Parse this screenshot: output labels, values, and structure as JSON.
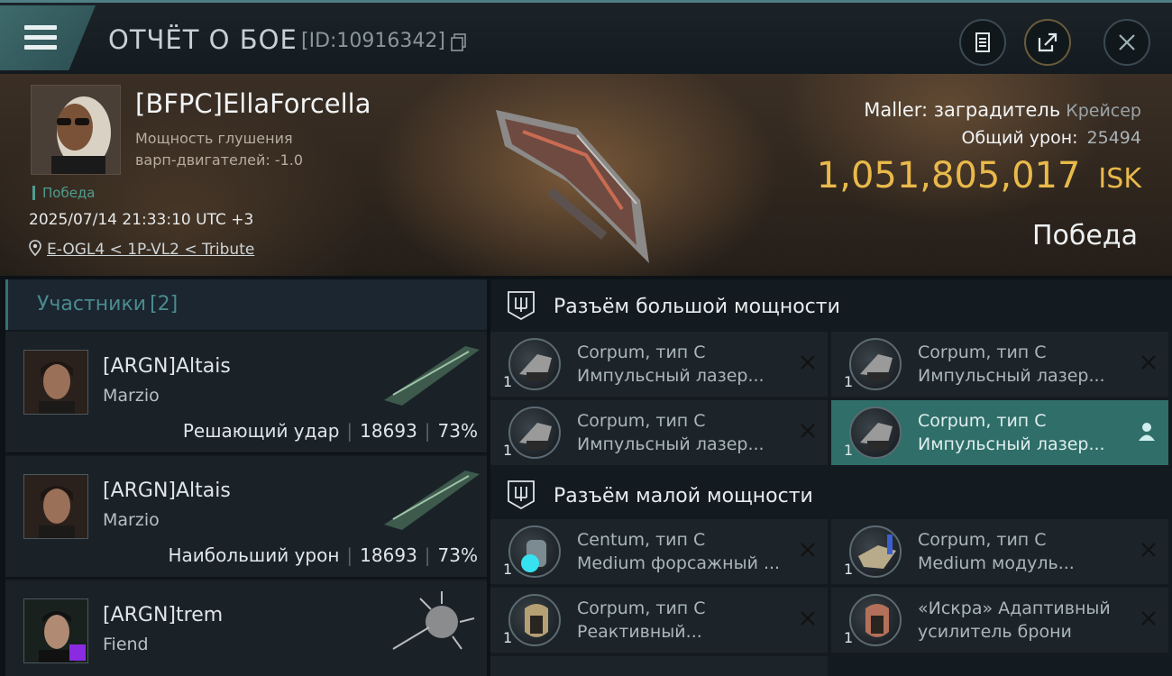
{
  "header": {
    "title": "ОТЧЁТ О БОЕ",
    "report_id": "[ID:10916342]",
    "icons": [
      "menu-icon",
      "copy-icon",
      "document-icon",
      "share-icon",
      "close-icon"
    ]
  },
  "victim": {
    "name": "[BFPC]EllaForcella",
    "stat_line1": "Мощность глушения",
    "stat_line2": "варп-двигателей: -1.0",
    "result": "Победа",
    "datetime": "2025/07/14 21:33:10 UTC +3",
    "location": "E-OGL4 < 1P-VL2 < Tribute",
    "ship_name": "Maller: заградитель",
    "ship_class": "Крейсер",
    "damage_label": "Общий урон:",
    "damage_value": "25494",
    "isk_value": "1,051,805,017",
    "isk_unit": "ISK",
    "outcome": "Победа"
  },
  "participants": {
    "title": "Участники",
    "count": "[2]",
    "rows": [
      {
        "name": "[ARGN]Altais",
        "ship": "Marzio",
        "role": "Решающий удар",
        "damage": "18693",
        "percent": "73%"
      },
      {
        "name": "[ARGN]Altais",
        "ship": "Marzio",
        "role": "Наибольший урон",
        "damage": "18693",
        "percent": "73%"
      },
      {
        "name": "[ARGN]trem",
        "ship": "Fiend"
      }
    ]
  },
  "fitting": {
    "high_title": "Разъём большой мощности",
    "low_title": "Разъём малой мощности",
    "high": [
      {
        "line1": "Corpum, тип C",
        "line2": "Импульсный лазер...",
        "qty": "1"
      },
      {
        "line1": "Corpum, тип C",
        "line2": "Импульсный лазер...",
        "qty": "1"
      },
      {
        "line1": "Corpum, тип C",
        "line2": "Импульсный лазер...",
        "qty": "1"
      },
      {
        "line1": "Corpum, тип C",
        "line2": "Импульсный лазер...",
        "qty": "1"
      }
    ],
    "low": [
      {
        "line1": "Centum, тип C",
        "line2": "Medium форсажный ...",
        "qty": "1"
      },
      {
        "line1": "Corpum, тип C",
        "line2": "Medium модуль...",
        "qty": "1"
      },
      {
        "line1": "Corpum, тип C",
        "line2": "Реактивный...",
        "qty": "1"
      },
      {
        "line1": "«Искра» Адаптивный",
        "line2": "усилитель брони",
        "qty": "1"
      }
    ]
  },
  "colors": {
    "accent": "#4b8b8f",
    "isk": "#e9b94a",
    "selected": "#2f6e69"
  }
}
